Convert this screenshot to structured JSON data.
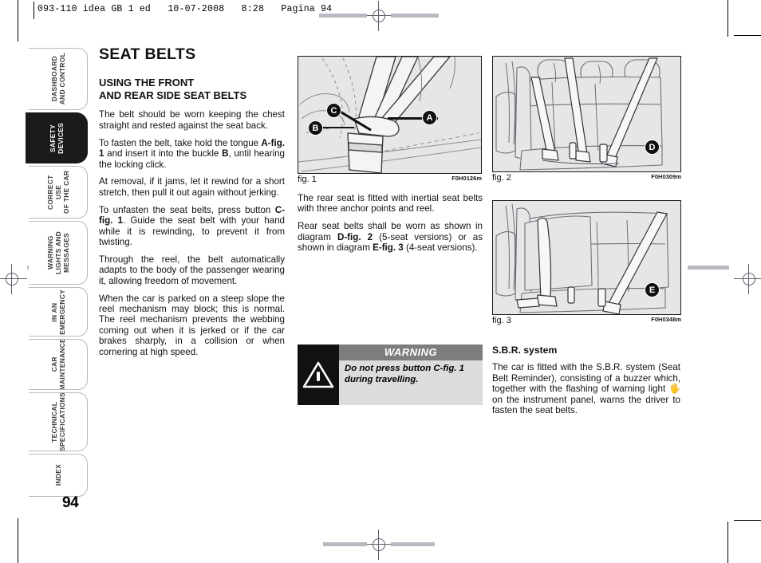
{
  "header": {
    "line": "093-110 idea GB 1 ed   10-07-2008   8:28   Pagina 94"
  },
  "sidebar": {
    "items": [
      {
        "label": "DASHBOARD\nAND CONTROL",
        "active": false
      },
      {
        "label": "SAFETY\nDEVICES",
        "active": true
      },
      {
        "label": "CORRECT USE\nOF THE CAR",
        "active": false
      },
      {
        "label": "WARNING\nLIGHTS AND\nMESSAGES",
        "active": false
      },
      {
        "label": "IN AN\nEMERGENCY",
        "active": false
      },
      {
        "label": "CAR\nMAINTENANCE",
        "active": false
      },
      {
        "label": "TECHNICAL\nSPECIFICATIONS",
        "active": false
      },
      {
        "label": "INDEX",
        "active": false
      }
    ]
  },
  "page_number": "94",
  "left_column": {
    "title": "SEAT BELTS",
    "subtitle": "USING THE FRONT\nAND REAR SIDE SEAT BELTS",
    "paragraphs": [
      "The belt should be worn keeping the chest straight and rested against the seat back.",
      "To fasten the belt, take hold the tongue <b>A-fig. 1</b> and insert it into the buckle <b>B</b>, until hearing the locking click.",
      "At removal, if it jams, let it rewind for a short stretch, then pull it out again without jerking.",
      "To unfasten the seat belts, press button <b>C-fig. 1</b>. Guide the seat belt with your hand while it is rewinding, to prevent it from twisting.",
      "Through the reel, the belt automatically adapts to the body of the passenger wearing it, allowing freedom of movement.",
      "When the car is parked on a steep slope the reel mechanism may block; this is normal. The reel mechanism prevents the webbing coming out when it is jerked or if the car brakes sharply, in a collision or when cornering at high speed."
    ]
  },
  "middle_column": {
    "paragraphs": [
      "The rear seat is fitted with inertial seat belts with three anchor points and reel.",
      "Rear seat belts shall be worn as shown in diagram <b>D-fig. 2</b> (5-seat versions) or as shown in diagram <b>E-fig. 3</b> (4-seat versions)."
    ]
  },
  "right_column": {
    "heading": "S.B.R. system",
    "paragraphs": [
      "The car is fitted with the S.B.R. system (Seat Belt Reminder), consisting of a buzzer which, together with the flashing of warning light <span class=\"sbr-glyph\">&#128400;</span> on the instrument panel, warns the driver to fasten the seat belts."
    ]
  },
  "figures": [
    {
      "id": "fig1",
      "caption": "fig. 1",
      "code": "F0H0126m",
      "callouts": [
        "A",
        "B",
        "C"
      ]
    },
    {
      "id": "fig2",
      "caption": "fig. 2",
      "code": "F0H0309m",
      "callouts": [
        "D"
      ]
    },
    {
      "id": "fig3",
      "caption": "fig. 3",
      "code": "F0H0348m",
      "callouts": [
        "E"
      ]
    }
  ],
  "warning": {
    "title": "WARNING",
    "text": "Do not press button C-fig. 1 during travelling."
  },
  "colors": {
    "active_tab_bg": "#1a1a1a",
    "figure_bg": "#e6e6e6",
    "warning_bg": "#dcdcdc",
    "warning_bar": "#7d7d7d"
  }
}
